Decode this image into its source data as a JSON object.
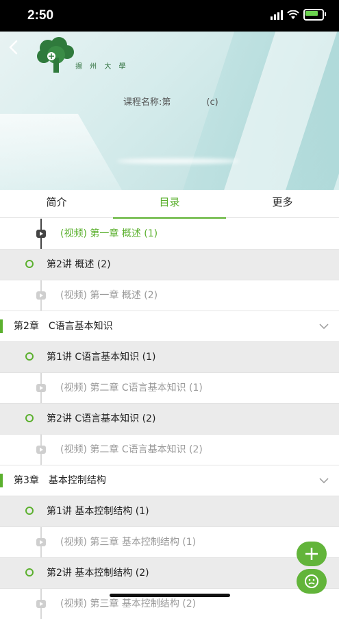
{
  "status": {
    "time": "2:50"
  },
  "header": {
    "logo_text": "揚 州 大 學",
    "course_title": "课程名称:第　　　　(c)"
  },
  "tabs": [
    {
      "label": "简介"
    },
    {
      "label": "目录",
      "active": true
    },
    {
      "label": "更多"
    }
  ],
  "list": {
    "r0": "(视频) 第一章 概述 (1)",
    "r1": "第2讲 概述 (2)",
    "r2": "(视频) 第一章 概述 (2)",
    "r3": "第2章　C语言基本知识",
    "r4": "第1讲 C语言基本知识 (1)",
    "r5": "(视频) 第二章 C语言基本知识 (1)",
    "r6": "第2讲 C语言基本知识 (2)",
    "r7": "(视频) 第二章 C语言基本知识 (2)",
    "r8": "第3章　基本控制结构",
    "r9": "第1讲 基本控制结构 (1)",
    "r10": "(视频) 第三章 基本控制结构 (1)",
    "r11": "第2讲 基本控制结构 (2)",
    "r12": "(视频) 第三章 基本控制结构 (2)"
  },
  "colors": {
    "accent": "#5bb02e",
    "lecture_bg": "#ebebeb"
  },
  "icons": [
    "back-icon",
    "university-logo",
    "video-icon",
    "circle-icon",
    "chevron-down-icon",
    "plus-icon",
    "feedback-face-icon"
  ]
}
